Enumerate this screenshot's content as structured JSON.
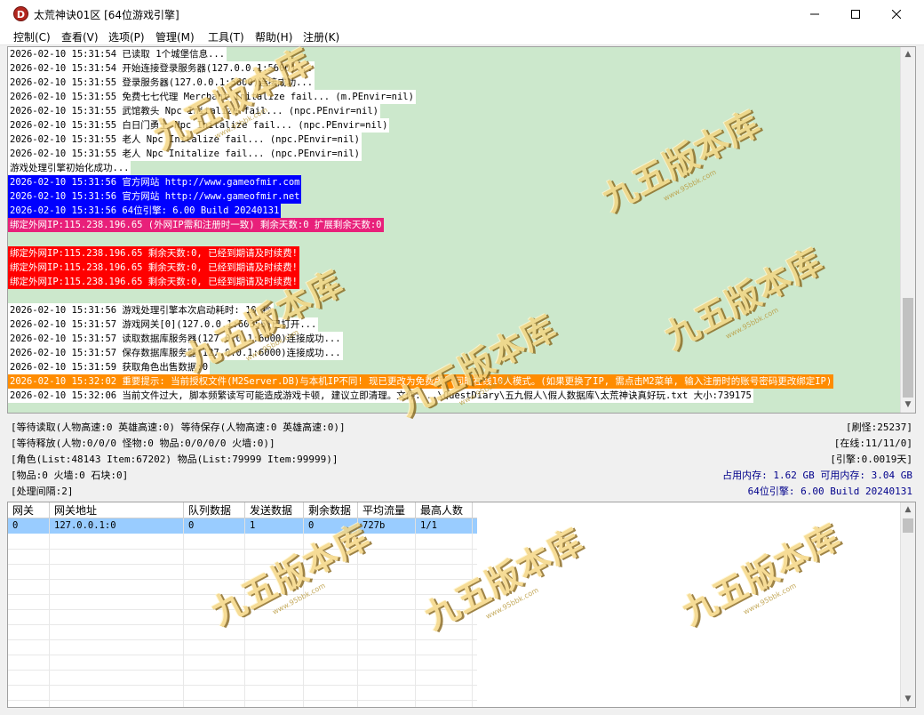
{
  "window": {
    "title": "太荒神诀01区 [64位游戏引擎]",
    "icon_letter": "D",
    "controls": [
      "minimize-icon",
      "maximize-icon",
      "close-icon"
    ]
  },
  "menu": [
    "控制(C)",
    "查看(V)",
    "选项(P)",
    "管理(M)",
    "工具(T)",
    "帮助(H)",
    "注册(K)"
  ],
  "log": [
    {
      "text": "2026-02-10 15:31:54 已读取 1个城堡信息...",
      "style": "bg-white"
    },
    {
      "text": "2026-02-10 15:31:54 开始连接登录服务器(127.0.0.1:5600)...",
      "style": "bg-white"
    },
    {
      "text": "2026-02-10 15:31:55 登录服务器(127.0.0.1:5600)连接成功...",
      "style": "bg-white"
    },
    {
      "text": "2026-02-10 15:31:55 免费七七代理 Merchant Initalize fail... (m.PEnvir=nil)",
      "style": "bg-white"
    },
    {
      "text": "2026-02-10 15:31:55 武馆教头 Npc Initalize fail... (npc.PEnvir=nil)",
      "style": "bg-white"
    },
    {
      "text": "2026-02-10 15:31:55 白日门勇士 Npc Initalize fail... (npc.PEnvir=nil)",
      "style": "bg-white"
    },
    {
      "text": "2026-02-10 15:31:55 老人 Npc Initalize fail... (npc.PEnvir=nil)",
      "style": "bg-white"
    },
    {
      "text": "2026-02-10 15:31:55 老人 Npc Initalize fail... (npc.PEnvir=nil)",
      "style": "bg-white"
    },
    {
      "text": "游戏处理引擎初始化成功...",
      "style": "bg-white"
    },
    {
      "text": "2026-02-10 15:31:56 官方网站 http://www.gameofmir.com",
      "style": "bg-blue"
    },
    {
      "text": "2026-02-10 15:31:56 官方网站 http://www.gameofmir.net",
      "style": "bg-blue"
    },
    {
      "text": "2026-02-10 15:31:56 64位引擎: 6.00 Build 20240131",
      "style": "bg-blue"
    },
    {
      "text": "绑定外网IP:115.238.196.65 (外网IP需和注册时一致) 剩余天数:0 扩展剩余天数:0",
      "style": "bg-pink"
    },
    {
      "text": "",
      "style": "bg-none"
    },
    {
      "text": "绑定外网IP:115.238.196.65 剩余天数:0, 已经到期请及时续费!",
      "style": "bg-red"
    },
    {
      "text": "绑定外网IP:115.238.196.65 剩余天数:0, 已经到期请及时续费!",
      "style": "bg-red"
    },
    {
      "text": "绑定外网IP:115.238.196.65 剩余天数:0, 已经到期请及时续费!",
      "style": "bg-red"
    },
    {
      "text": "",
      "style": "bg-none"
    },
    {
      "text": "2026-02-10 15:31:56 游戏处理引擎本次启动耗时: 10 秒",
      "style": "bg-white"
    },
    {
      "text": "2026-02-10 15:31:57 游戏网关[0](127.0.0.1:60355)已打开...",
      "style": "bg-white"
    },
    {
      "text": "2026-02-10 15:31:57 读取数据库服务器(127.0.0.1:6000)连接成功...",
      "style": "bg-white"
    },
    {
      "text": "2026-02-10 15:31:57 保存数据库服务器(127.0.0.1:6000)连接成功...",
      "style": "bg-white"
    },
    {
      "text": "2026-02-10 15:31:59 获取角色出售数据:0",
      "style": "bg-white"
    },
    {
      "text": "2026-02-10 15:32:02 重要提示: 当前授权文件(M2Server.DB)与本机IP不同! 现已更改为免费版, 同时在线10人模式。(如果更换了IP, 需点击M2菜单, 输入注册时的账号密码更改绑定IP)",
      "style": "bg-orange"
    },
    {
      "text": "2026-02-10 15:32:06 当前文件过大, 脚本频繁读写可能造成游戏卡顿, 建议立即清理。文件: ..\\QuestDiary\\五九假人\\假人数据库\\太荒神诀真好玩.txt 大小:739175",
      "style": "bg-white"
    }
  ],
  "status": {
    "line1": "[等待读取(人物高速:0 英雄高速:0) 等待保存(人物高速:0 英雄高速:0)]",
    "line2": "[等待释放(人物:0/0/0 怪物:0 物品:0/0/0/0 火墙:0)]",
    "line3": "[角色(List:48143 Item:67202) 物品(List:79999 Item:99999)]",
    "line4": "[物品:0 火墙:0 石块:0]",
    "line5": "[处理间隔:2]",
    "refresh": "[刷怪:25237]",
    "online": "[在线:11/11/0]",
    "engine": "[引擎:0.0019天]",
    "memory": "占用内存: 1.62 GB 可用内存: 3.04 GB",
    "build": "64位引擎: 6.00 Build 20240131"
  },
  "gateway_table": {
    "columns": [
      "网关",
      "网关地址",
      "队列数据",
      "发送数据",
      "剩余数据",
      "平均流量",
      "最高人数"
    ],
    "rows": [
      [
        "0",
        "127.0.0.1:0",
        "0",
        "1",
        "0",
        "727b",
        "1/1"
      ]
    ]
  },
  "watermark": {
    "text": "九五版本库",
    "url": "www.95bbk.com"
  }
}
